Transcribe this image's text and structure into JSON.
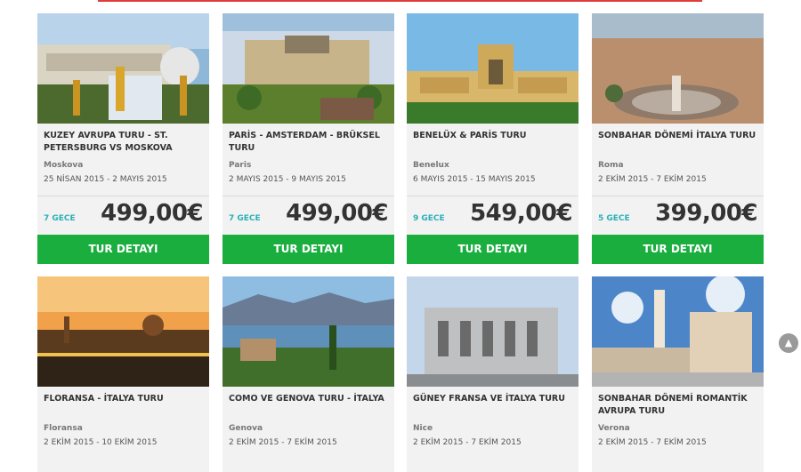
{
  "cta_label": "TUR DETAYI",
  "tours": [
    {
      "title": "KUZEY AVRUPA TURU - ST. PETERSBURG VS MOSKOVA",
      "city": "Moskova",
      "dates": "25 NİSAN 2015 - 2 MAYIS 2015",
      "nights": "7 GECE",
      "price": "499,00€"
    },
    {
      "title": "PARİS - AMSTERDAM - BRÜKSEL TURU",
      "city": "Paris",
      "dates": "2 MAYIS 2015 - 9 MAYIS 2015",
      "nights": "7 GECE",
      "price": "499,00€"
    },
    {
      "title": "BENELÜX & PARİS TURU",
      "city": "Benelux",
      "dates": "6 MAYIS 2015 - 15 MAYIS 2015",
      "nights": "9 GECE",
      "price": "549,00€"
    },
    {
      "title": "SONBAHAR DÖNEMİ İTALYA TURU",
      "city": "Roma",
      "dates": "2 EKİM 2015 - 7 EKİM 2015",
      "nights": "5 GECE",
      "price": "399,00€"
    },
    {
      "title": "FLORANSA - İTALYA TURU",
      "city": "Floransa",
      "dates": "2 EKİM 2015 - 10 EKİM 2015"
    },
    {
      "title": "COMO VE GENOVA TURU - İTALYA",
      "city": "Genova",
      "dates": "2 EKİM 2015 - 7 EKİM 2015"
    },
    {
      "title": "GÜNEY FRANSA VE İTALYA TURU",
      "city": "Nice",
      "dates": "2 EKİM 2015 - 7 EKİM 2015"
    },
    {
      "title": "SONBAHAR DÖNEMİ ROMANTİK AVRUPA TURU",
      "city": "Verona",
      "dates": "2 EKİM 2015 - 7 EKİM 2015"
    }
  ],
  "colors": {
    "accent_green": "#1aae3f",
    "nights_teal": "#2bb0b7",
    "top_rule": "#e23b3b"
  },
  "icons": {
    "scroll_top": "chevron-up-icon"
  }
}
